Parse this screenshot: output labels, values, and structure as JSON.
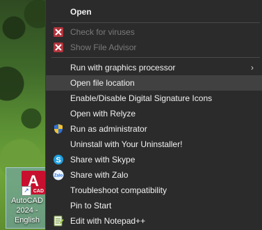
{
  "desktop": {
    "icon_badge": "A",
    "icon_sub": "CAD",
    "shortcut_glyph": "↗",
    "icon_label": "AutoCAD 2024 - English"
  },
  "menu": {
    "open": "Open",
    "check_viruses": "Check for viruses",
    "show_file_advisor": "Show File Advisor",
    "run_graphics": "Run with graphics processor",
    "open_file_location": "Open file location",
    "digital_signature": "Enable/Disable Digital Signature Icons",
    "open_relyze": "Open with Relyze",
    "run_admin": "Run as administrator",
    "uninstall": "Uninstall with Your Uninstaller!",
    "share_skype": "Share with Skype",
    "share_zalo": "Share with Zalo",
    "troubleshoot": "Troubleshoot compatibility",
    "pin_start": "Pin to Start",
    "edit_notepad": "Edit with Notepad++",
    "submenu_chevron": "›"
  },
  "icons": {
    "skype_letter": "S",
    "zalo_text": "Zalo"
  }
}
